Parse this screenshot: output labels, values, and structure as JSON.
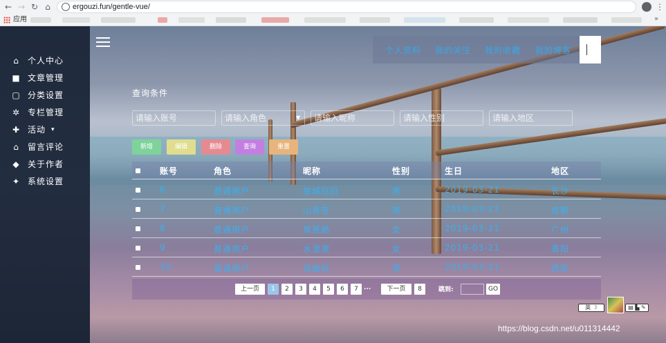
{
  "browser": {
    "url": "ergouzi.fun/gentle-vue/",
    "apps_label": "应用"
  },
  "sidebar": {
    "items": [
      {
        "label": "个人中心",
        "icon": "home-icon"
      },
      {
        "label": "文章管理",
        "icon": "folder-icon"
      },
      {
        "label": "分类设置",
        "icon": "file-icon"
      },
      {
        "label": "专栏管理",
        "icon": "gear-icon"
      },
      {
        "label": "活动",
        "icon": "plus-icon",
        "caret": "▾"
      },
      {
        "label": "留言评论",
        "icon": "bank-icon"
      },
      {
        "label": "关于作者",
        "icon": "dropbox-icon"
      },
      {
        "label": "系统设置",
        "icon": "twitter-icon"
      }
    ]
  },
  "topnav": {
    "links": [
      "个人资料",
      "我的关注",
      "我的收藏",
      "我的博客"
    ]
  },
  "query": {
    "title": "查询条件",
    "placeholders": [
      "请输入账号",
      "请输入角色",
      "请输入昵称",
      "请输入性别",
      "请输入地区"
    ]
  },
  "buttons": {
    "add": "新增",
    "edit": "编辑",
    "delete": "删除",
    "search": "查询",
    "reset": "重置"
  },
  "colors": {
    "add": "#7fd39a",
    "edit": "#e0dd8f",
    "delete": "#e68a92",
    "search": "#c27fe0",
    "reset": "#e7b47c",
    "link": "#3aa6e8"
  },
  "table": {
    "headers": [
      "账号",
      "角色",
      "昵称",
      "性别",
      "生日",
      "地区"
    ],
    "rows": [
      [
        "6",
        "普通用户",
        "故城旧旧",
        "男",
        "2019-03-21",
        "长沙"
      ],
      [
        "7",
        "普通用户",
        "山青苍",
        "男",
        "2019-03-21",
        "成都"
      ],
      [
        "8",
        "普通用户",
        "草葱脆",
        "女",
        "2019-03-21",
        "广州"
      ],
      [
        "9",
        "普通用户",
        "水澄澈",
        "女",
        "2019-03-21",
        "青阳"
      ],
      [
        "10",
        "普通用户",
        "径曲斜",
        "男",
        "2019-03-21",
        "西安"
      ]
    ]
  },
  "pager": {
    "prev": "上一页",
    "pages": [
      "1",
      "2",
      "3",
      "4",
      "5",
      "6",
      "7"
    ],
    "active": "1",
    "ellipsis": "...",
    "next": "下一页",
    "last": "8",
    "jump_label": "跳到:",
    "go": "GO"
  },
  "widget": {
    "lang": "英",
    "moon": "☽",
    "tools": "▤ ▙ ✎"
  },
  "watermark": "https://blog.csdn.net/u011314442"
}
